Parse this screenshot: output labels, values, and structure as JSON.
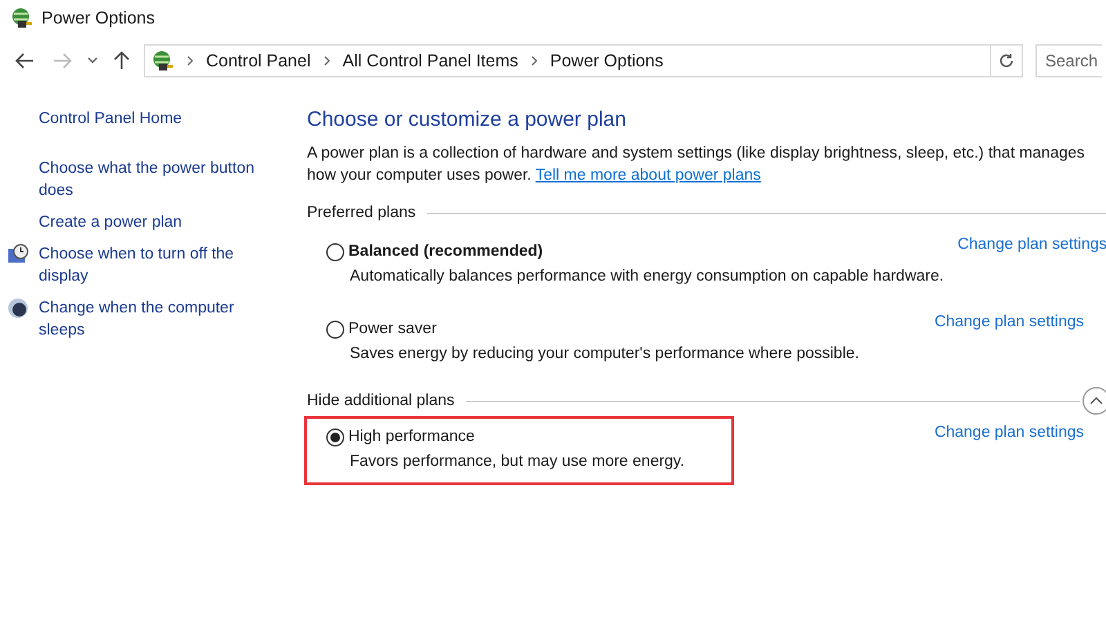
{
  "window": {
    "title": "Power Options"
  },
  "address_bar": {
    "breadcrumbs": [
      "Control Panel",
      "All Control Panel Items",
      "Power Options"
    ],
    "search_placeholder": "Search"
  },
  "sidebar": {
    "items": [
      {
        "label": "Control Panel Home",
        "kind": "plain"
      },
      {
        "label": "Choose what the power button does",
        "kind": "plain"
      },
      {
        "label": "Create a power plan",
        "kind": "plain"
      },
      {
        "label": "Choose when to turn off the display",
        "kind": "display"
      },
      {
        "label": "Change when the computer sleeps",
        "kind": "sleep"
      }
    ]
  },
  "main": {
    "heading": "Choose or customize a power plan",
    "description": "A power plan is a collection of hardware and system settings (like display brightness, sleep, etc.) that manages how your computer uses power.",
    "description_link": "Tell me more about power plans",
    "groups": [
      {
        "title": "Preferred plans",
        "plans": [
          {
            "name": "Balanced (recommended)",
            "emphasized": true,
            "description": "Automatically balances performance with energy consumption on capable hardware.",
            "selected": false,
            "highlighted": false,
            "action": "Change plan settings"
          },
          {
            "name": "Power saver",
            "emphasized": false,
            "description": "Saves energy by reducing your computer's performance where possible.",
            "selected": false,
            "highlighted": false,
            "action": "Change plan settings"
          }
        ]
      },
      {
        "title": "Hide additional plans",
        "expanded": true,
        "plans": [
          {
            "name": "High performance",
            "emphasized": false,
            "description": "Favors performance, but may use more energy.",
            "selected": true,
            "highlighted": true,
            "action": "Change plan settings"
          }
        ]
      }
    ]
  }
}
